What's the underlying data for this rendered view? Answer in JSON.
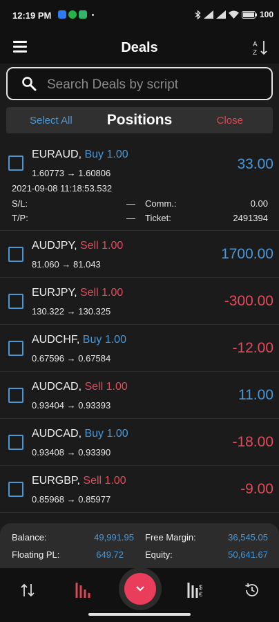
{
  "status_bar": {
    "time": "12:19 PM",
    "battery": "100"
  },
  "header": {
    "title": "Deals"
  },
  "search": {
    "placeholder": "Search Deals by script"
  },
  "tabs": {
    "select_all": "Select All",
    "positions": "Positions",
    "close": "Close"
  },
  "deals": [
    {
      "symbol": "EURAUD,",
      "side": "Buy",
      "lots": "1.00",
      "open": "1.60773",
      "current": "1.60806",
      "profit": "33.00",
      "expanded": true,
      "time": "2021-09-08 11:18:53.532",
      "sl_label": "S/L:",
      "sl": "—",
      "tp_label": "T/P:",
      "tp": "—",
      "comm_label": "Comm.:",
      "comm": "0.00",
      "ticket_label": "Ticket:",
      "ticket": "2491394"
    },
    {
      "symbol": "AUDJPY,",
      "side": "Sell",
      "lots": "1.00",
      "open": "81.060",
      "current": "81.043",
      "profit": "1700.00"
    },
    {
      "symbol": "EURJPY,",
      "side": "Sell",
      "lots": "1.00",
      "open": "130.322",
      "current": "130.325",
      "profit": "-300.00"
    },
    {
      "symbol": "AUDCHF,",
      "side": "Buy",
      "lots": "1.00",
      "open": "0.67596",
      "current": "0.67584",
      "profit": "-12.00"
    },
    {
      "symbol": "AUDCAD,",
      "side": "Sell",
      "lots": "1.00",
      "open": "0.93404",
      "current": "0.93393",
      "profit": "11.00"
    },
    {
      "symbol": "AUDCAD,",
      "side": "Buy",
      "lots": "1.00",
      "open": "0.93408",
      "current": "0.93390",
      "profit": "-18.00"
    },
    {
      "symbol": "EURGBP,",
      "side": "Sell",
      "lots": "1.00",
      "open": "0.85968",
      "current": "0.85977",
      "profit": "-9.00"
    }
  ],
  "arrow": "→",
  "summary": {
    "balance_label": "Balance:",
    "balance": "49,991.95",
    "free_margin_label": "Free Margin:",
    "free_margin": "36,545.05",
    "floating_pl_label": "Floating PL:",
    "floating_pl": "649.72",
    "equity_label": "Equity:",
    "equity": "50,641.67"
  },
  "colors": {
    "buy": "#4a97d7",
    "sell": "#e24b5b",
    "accent": "#ea3d5c"
  },
  "icons": [
    "menu-icon",
    "sort-az-icon",
    "search-icon",
    "transfer-icon",
    "positions-chart-icon",
    "chevron-down-icon",
    "quotes-chart-icon",
    "history-icon"
  ]
}
